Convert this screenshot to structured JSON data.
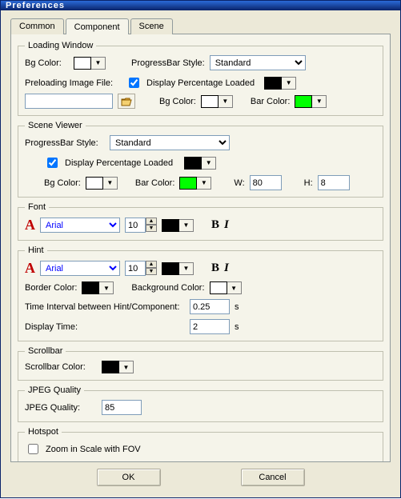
{
  "window": {
    "title": "Preferences"
  },
  "tabs": {
    "common": "Common",
    "component": "Component",
    "scene": "Scene",
    "active": "Component"
  },
  "loadingWindow": {
    "legend": "Loading Window",
    "bgColorLabel": "Bg Color:",
    "bgColor": "#ffffff",
    "progressBarStyleLabel": "ProgressBar Style:",
    "progressBarStyle": "Standard",
    "preloadingLabel": "Preloading Image File:",
    "preloadingFile": "",
    "displayPctLabel": "Display Percentage Loaded",
    "displayPctChecked": true,
    "innerBgColorLabel": "Bg Color:",
    "innerBgColor": "#ffffff",
    "barColorLabel": "Bar Color:",
    "barColor": "#00ff00"
  },
  "sceneViewer": {
    "legend": "Scene Viewer",
    "progressBarStyleLabel": "ProgressBar Style:",
    "progressBarStyle": "Standard",
    "displayPctLabel": "Display Percentage Loaded",
    "displayPctChecked": true,
    "bgColorLabel": "Bg Color:",
    "bgColor": "#ffffff",
    "barColorLabel": "Bar Color:",
    "barColor": "#00ff00",
    "wLabel": "W:",
    "wValue": "80",
    "hLabel": "H:",
    "hValue": "8"
  },
  "font": {
    "legend": "Font",
    "family": "Arial",
    "size": "10",
    "color": "#000000"
  },
  "hint": {
    "legend": "Hint",
    "family": "Arial",
    "size": "10",
    "color": "#000000",
    "borderColorLabel": "Border Color:",
    "borderColor": "#000000",
    "backgroundColorLabel": "Background Color:",
    "backgroundColor": "#ffffff",
    "timeIntervalLabel": "Time Interval between Hint/Component:",
    "timeIntervalValue": "0.25",
    "timeIntervalUnit": "s",
    "displayTimeLabel": "Display Time:",
    "displayTimeValue": "2",
    "displayTimeUnit": "s"
  },
  "scrollbar": {
    "legend": "Scrollbar",
    "colorLabel": "Scrollbar Color:",
    "color": "#000000"
  },
  "jpeg": {
    "legend": "JPEG Quality",
    "label": "JPEG Quality:",
    "value": "85"
  },
  "hotspot": {
    "legend": "Hotspot",
    "zoomLabel": "Zoom in Scale with FOV",
    "zoomChecked": false
  },
  "buttons": {
    "ok": "OK",
    "cancel": "Cancel"
  }
}
